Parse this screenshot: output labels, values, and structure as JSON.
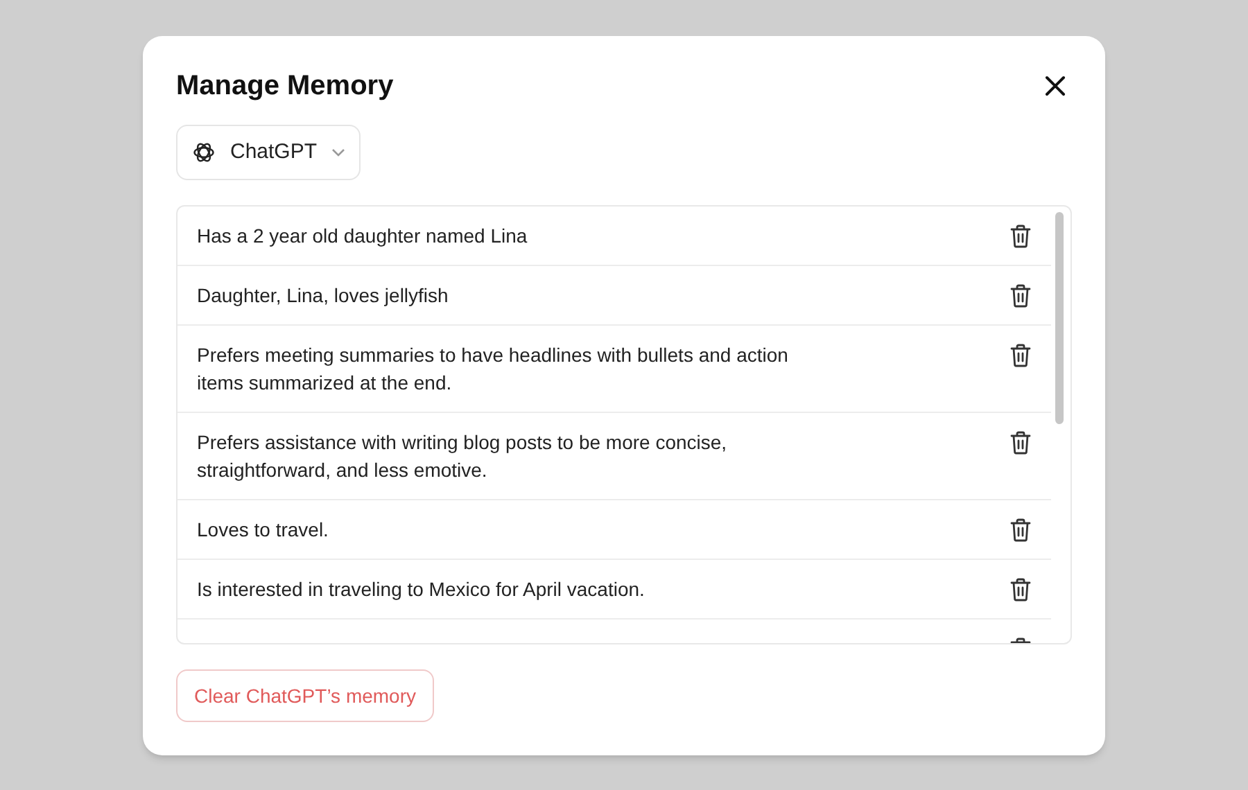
{
  "dialog": {
    "title": "Manage Memory"
  },
  "model_selector": {
    "label": "ChatGPT"
  },
  "memories": [
    {
      "text": "Has a 2 year old daughter named Lina"
    },
    {
      "text": "Daughter, Lina, loves jellyfish"
    },
    {
      "text": "Prefers meeting summaries to have headlines with bullets and action items summarized at the end."
    },
    {
      "text": "Prefers assistance with writing blog posts to be more concise, straightforward, and less emotive."
    },
    {
      "text": "Loves to travel."
    },
    {
      "text": "Is interested in traveling to Mexico for April vacation."
    }
  ],
  "clear_button": {
    "label": "Clear ChatGPT’s memory"
  }
}
